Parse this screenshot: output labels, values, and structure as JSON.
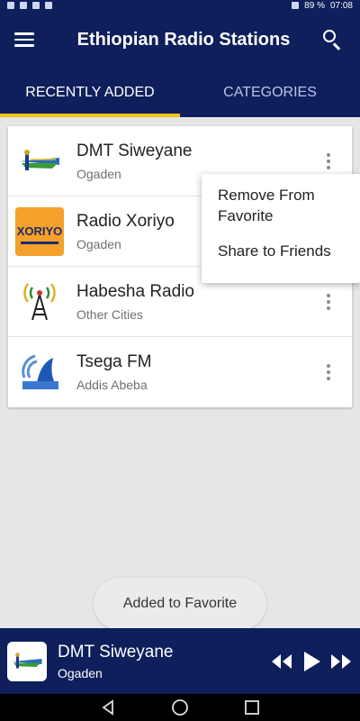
{
  "status": {
    "battery": "89 %",
    "time": "07:08"
  },
  "header": {
    "title": "Ethiopian Radio Stations"
  },
  "tabs": [
    {
      "label": "RECENTLY ADDED",
      "active": true
    },
    {
      "label": "CATEGORIES",
      "active": false
    }
  ],
  "stations": [
    {
      "name": "DMT Siweyane",
      "location": "Ogaden",
      "icon": "dmt-logo-icon"
    },
    {
      "name": "Radio Xoriyo",
      "location": "Ogaden",
      "icon": "radio-xoriyo-logo-icon",
      "logo_text": "XORIYO"
    },
    {
      "name": "Habesha Radio",
      "location": "Other Cities",
      "icon": "radio-tower-icon"
    },
    {
      "name": "Tsega FM",
      "location": "Addis Abeba",
      "icon": "tsega-fm-logo-icon"
    }
  ],
  "popup_menu": {
    "items": [
      "Remove From Favorite",
      "Share to Friends"
    ]
  },
  "toast": {
    "message": "Added to Favorite"
  },
  "player": {
    "title": "DMT Siweyane",
    "subtitle": "Ogaden"
  },
  "colors": {
    "primary": "#0e1f5c",
    "accent": "#f2c418"
  }
}
